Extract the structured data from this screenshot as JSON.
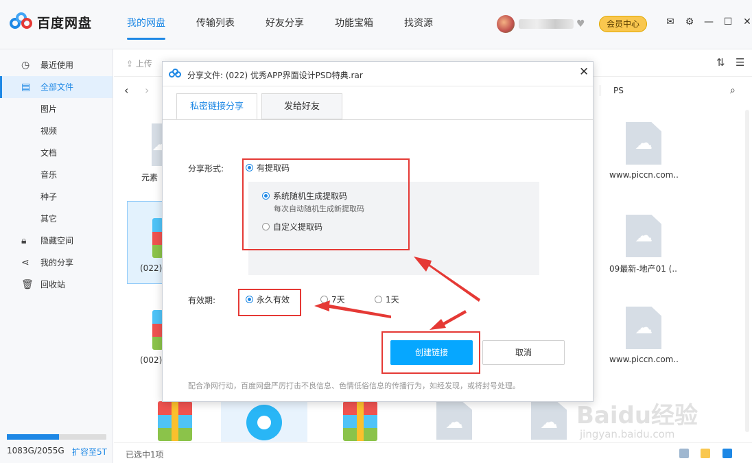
{
  "app": {
    "name": "百度网盘"
  },
  "nav": {
    "tabs": [
      "我的网盘",
      "传输列表",
      "好友分享",
      "功能宝箱",
      "找资源"
    ],
    "active": 0
  },
  "header": {
    "vip_label": "会员中心",
    "icons": [
      "mail-icon",
      "settings-icon",
      "minimize-icon",
      "maximize-icon",
      "close-icon"
    ]
  },
  "sidebar": {
    "items": [
      {
        "label": "最近使用",
        "icon": "clock-icon"
      },
      {
        "label": "全部文件",
        "icon": "file-icon"
      },
      {
        "label": "图片"
      },
      {
        "label": "视频"
      },
      {
        "label": "文档"
      },
      {
        "label": "音乐"
      },
      {
        "label": "种子"
      },
      {
        "label": "其它"
      },
      {
        "label": "隐藏空间",
        "icon": "lock-icon"
      },
      {
        "label": "我的分享",
        "icon": "share-icon"
      },
      {
        "label": "回收站",
        "icon": "trash-icon"
      }
    ],
    "active": 1,
    "quota": {
      "text": "1083G/2055G",
      "used_fraction": 0.527,
      "upgrade_label": "扩容至5T"
    }
  },
  "toolbar": {
    "upload_label": "上传"
  },
  "pathbar": {
    "current_folder": "PS"
  },
  "files": {
    "left_col": [
      "元素",
      "(022)",
      "(002)"
    ],
    "right_col": [
      "www.piccn.com...",
      "09最新-地产01 (...",
      "www.piccn.com..."
    ]
  },
  "status": {
    "selected": "已选中1项"
  },
  "dialog": {
    "title_prefix": "分享文件:",
    "file_name": "(022) 优秀APP界面设计PSD特典.rar",
    "tabs": [
      "私密链接分享",
      "发给好友"
    ],
    "share_form_label": "分享形式:",
    "share_form_option": "有提取码",
    "code_options": [
      {
        "label": "系统随机生成提取码",
        "hint": "每次自动随机生成新提取码",
        "checked": true
      },
      {
        "label": "自定义提取码",
        "checked": false
      }
    ],
    "validity_label": "有效期:",
    "validity_options": [
      {
        "label": "永久有效",
        "checked": true
      },
      {
        "label": "7天",
        "checked": false
      },
      {
        "label": "1天",
        "checked": false
      }
    ],
    "create_button": "创建链接",
    "cancel_button": "取消",
    "notice": "配合净网行动，百度网盘严厉打击不良信息、色情低俗信息的传播行为，如经发现，或将封号处理。"
  },
  "watermark": {
    "text": "Baidu经验",
    "sub": "jingyan.baidu.com"
  },
  "colors": {
    "accent": "#1e88e5",
    "primary_button": "#06a7ff",
    "annotation": "#e53935",
    "vip": "#f9c74f"
  }
}
